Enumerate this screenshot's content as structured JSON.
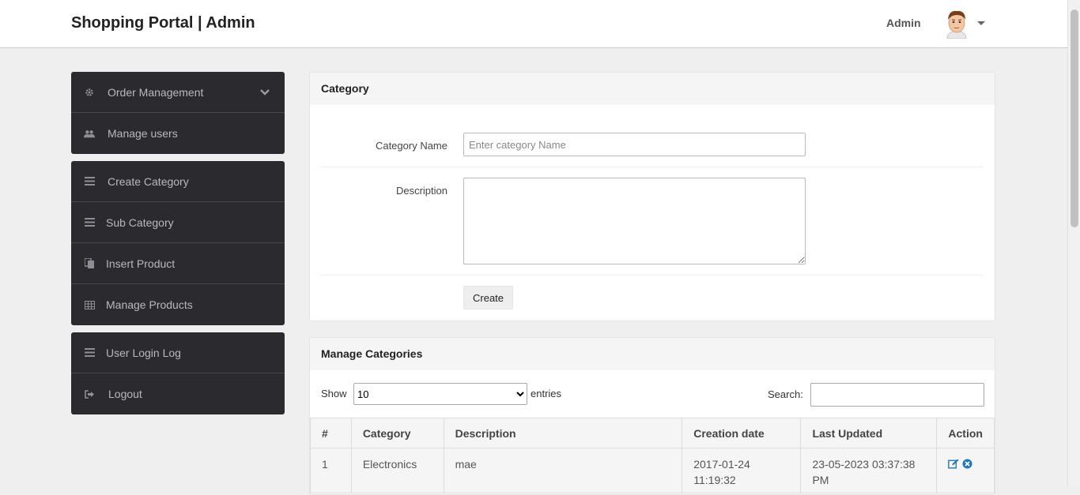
{
  "header": {
    "brand": "Shopping Portal | Admin",
    "user_label": "Admin"
  },
  "sidebar": {
    "group1": [
      {
        "label": "Order Management",
        "icon": "gear-icon",
        "has_chevron": true
      },
      {
        "label": "Manage users",
        "icon": "users-icon"
      }
    ],
    "group2": [
      {
        "label": "Create Category",
        "icon": "list-icon"
      },
      {
        "label": "Sub Category",
        "icon": "list-icon"
      },
      {
        "label": "Insert Product",
        "icon": "copy-icon"
      },
      {
        "label": "Manage Products",
        "icon": "table-icon"
      }
    ],
    "group3": [
      {
        "label": "User Login Log",
        "icon": "list-icon"
      },
      {
        "label": "Logout",
        "icon": "signout-icon"
      }
    ]
  },
  "category_form": {
    "title": "Category",
    "name_label": "Category Name",
    "name_placeholder": "Enter category Name",
    "name_value": "",
    "description_label": "Description",
    "description_value": "",
    "submit_label": "Create"
  },
  "manage_categories": {
    "title": "Manage Categories",
    "show_label": "Show",
    "entries_selected": "10",
    "entries_label": "entries",
    "search_label": "Search:",
    "search_value": "",
    "columns": [
      "#",
      "Category",
      "Description",
      "Creation date",
      "Last Updated",
      "Action"
    ],
    "rows": [
      {
        "num": "1",
        "category": "Electronics",
        "description": "mae",
        "created": "2017-01-24 11:19:32",
        "updated": "23-05-2023 03:37:38 PM"
      }
    ]
  },
  "colors": {
    "sidebar_bg": "#2b2b2f",
    "action_icon": "#1f78c1",
    "page_bg": "#efefef"
  }
}
